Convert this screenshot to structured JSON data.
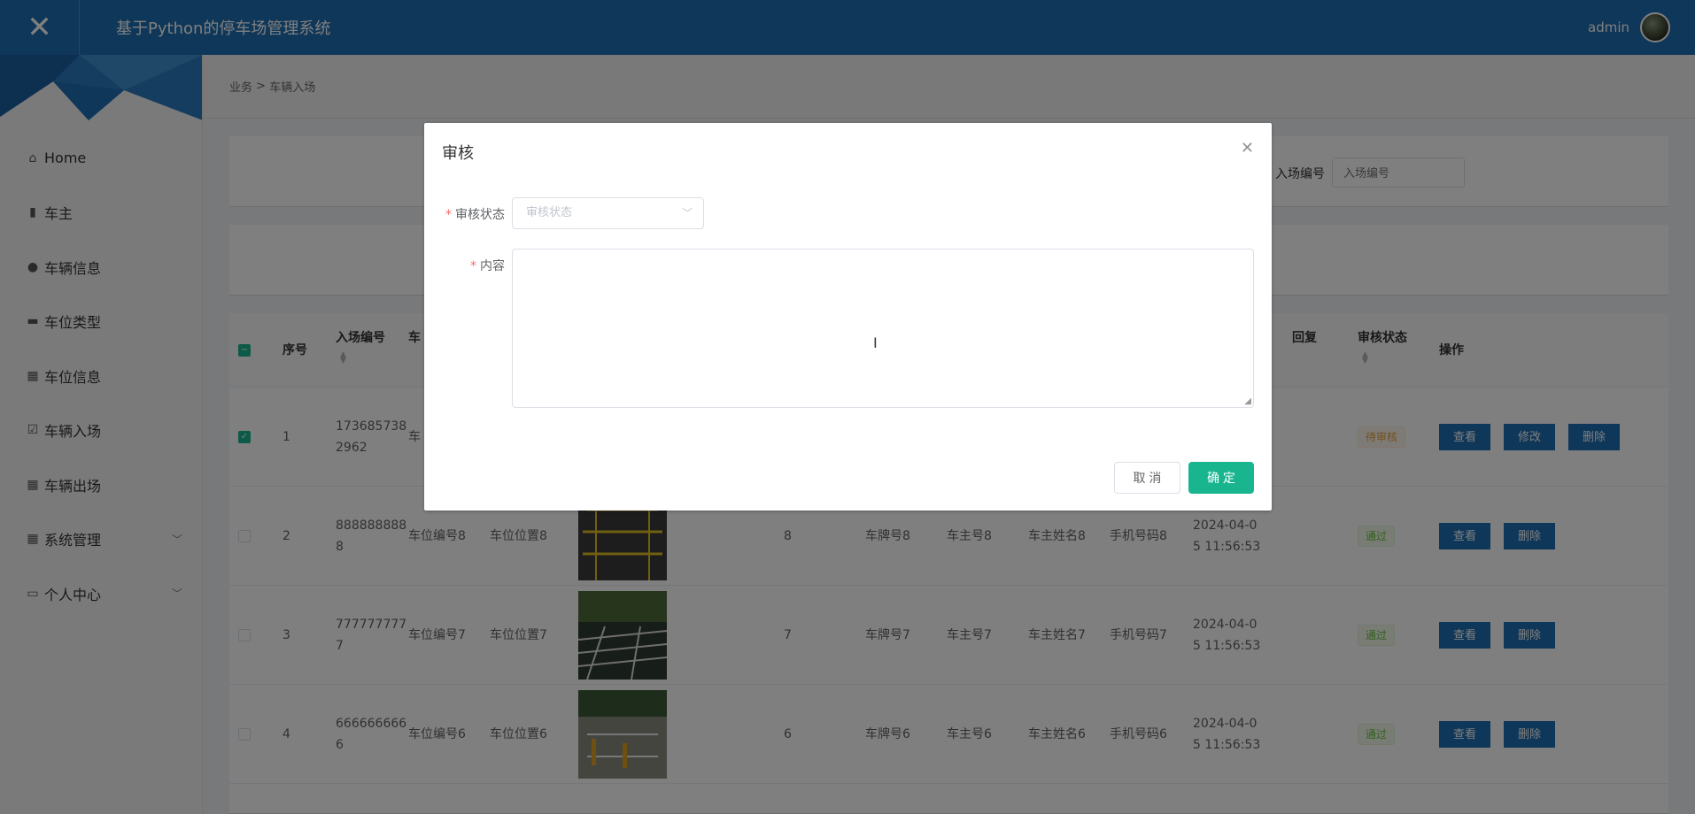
{
  "header": {
    "close_icon": "close-icon",
    "app_title": "基于Python的停车场管理系统",
    "user_name": "admin"
  },
  "sidebar": {
    "items": [
      {
        "label": "Home",
        "icon": "home-icon"
      },
      {
        "label": "车主",
        "icon": "book-icon"
      },
      {
        "label": "车辆信息",
        "icon": "user-icon"
      },
      {
        "label": "车位类型",
        "icon": "briefcase-icon"
      },
      {
        "label": "车位信息",
        "icon": "grid-icon"
      },
      {
        "label": "车辆入场",
        "icon": "check-square-icon"
      },
      {
        "label": "车辆出场",
        "icon": "grid9-icon"
      },
      {
        "label": "系统管理",
        "icon": "grid-icon",
        "has_children": true
      },
      {
        "label": "个人中心",
        "icon": "card-icon",
        "has_children": true
      }
    ]
  },
  "breadcrumb": {
    "parent": "业务",
    "separator": ">",
    "current": "车辆入场"
  },
  "search": {
    "label": "入场编号",
    "placeholder": "入场编号"
  },
  "table": {
    "headers": {
      "index": "序号",
      "entry_no": "入场编号",
      "owner_col": "车",
      "reply": "回复",
      "audit_status": "审核状态",
      "actions": "操作"
    },
    "rows": [
      {
        "index": "1",
        "entry_no_1": "173685738",
        "entry_no_2": "2962",
        "spot_no": "车",
        "spot_pos": "",
        "spaces": "",
        "plate": "",
        "owner_no": "",
        "owner_name": "",
        "phone": "",
        "time_1": "",
        "time_2": "",
        "status": "待审核",
        "status_type": "warn",
        "checked": true,
        "buttons": [
          "查看",
          "修改",
          "删除"
        ]
      },
      {
        "index": "2",
        "entry_no_1": "888888888",
        "entry_no_2": "8",
        "spot_no": "车位编号8",
        "spot_pos": "车位位置8",
        "spaces": "8",
        "plate": "车牌号8",
        "owner_no": "车主号8",
        "owner_name": "车主姓名8",
        "phone": "手机号码8",
        "time_1": "2024-04-0",
        "time_2": "5 11:56:53",
        "status": "通过",
        "status_type": "ok",
        "checked": false,
        "buttons": [
          "查看",
          "删除"
        ]
      },
      {
        "index": "3",
        "entry_no_1": "777777777",
        "entry_no_2": "7",
        "spot_no": "车位编号7",
        "spot_pos": "车位位置7",
        "spaces": "7",
        "plate": "车牌号7",
        "owner_no": "车主号7",
        "owner_name": "车主姓名7",
        "phone": "手机号码7",
        "time_1": "2024-04-0",
        "time_2": "5 11:56:53",
        "status": "通过",
        "status_type": "ok",
        "checked": false,
        "buttons": [
          "查看",
          "删除"
        ]
      },
      {
        "index": "4",
        "entry_no_1": "666666666",
        "entry_no_2": "6",
        "spot_no": "车位编号6",
        "spot_pos": "车位位置6",
        "spaces": "6",
        "plate": "车牌号6",
        "owner_no": "车主号6",
        "owner_name": "车主姓名6",
        "phone": "手机号码6",
        "time_1": "2024-04-0",
        "time_2": "5 11:56:53",
        "status": "通过",
        "status_type": "ok",
        "checked": false,
        "buttons": [
          "查看",
          "删除"
        ]
      }
    ]
  },
  "dialog": {
    "title": "审核",
    "status_label": "审核状态",
    "status_placeholder": "审核状态",
    "content_label": "内容",
    "content_value": "",
    "cancel_label": "取 消",
    "ok_label": "确 定"
  },
  "colors": {
    "header": "#1f6fb3",
    "primary_button": "#1f6fb3",
    "confirm_button": "#18b58f",
    "pending": "#e6a23c",
    "approved": "#67c23a"
  }
}
